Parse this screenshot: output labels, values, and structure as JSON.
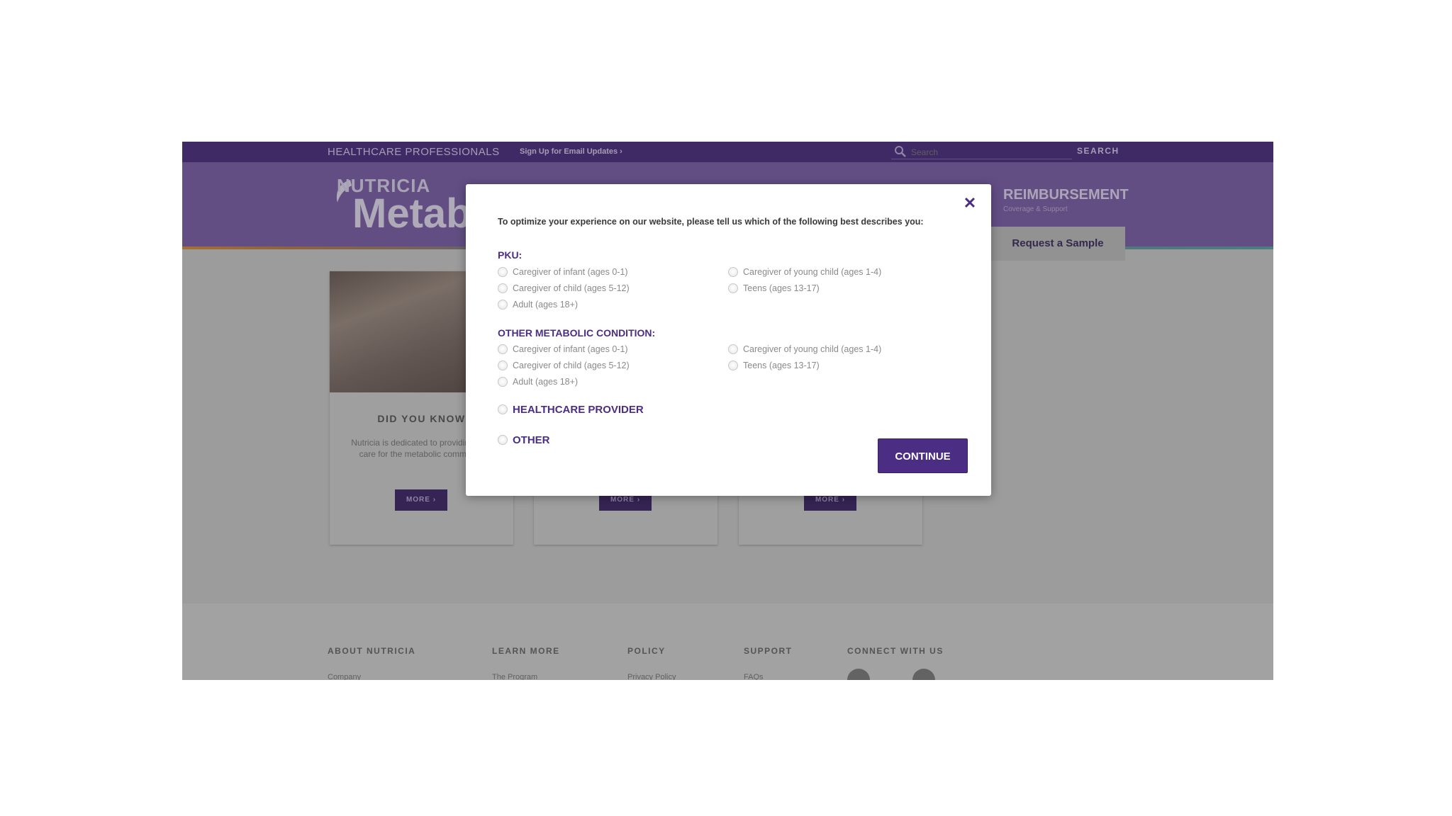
{
  "topbar": {
    "hcp_label": "HEALTHCARE PROFESSIONALS",
    "signup_label": "Sign Up for Email Updates ›",
    "search_placeholder": "Search",
    "search_button": "SEARCH"
  },
  "header": {
    "logo_top": "NUTRICIA",
    "logo_main": "Metab",
    "nav_reimbursement": "REIMBURSEMENT",
    "nav_reimbursement_sub": "Coverage & Support",
    "request_sample": "Request a Sample"
  },
  "cards": [
    {
      "title": "DID YOU KNOW",
      "body": "Nutricia is dedicated to providing best care for the metabolic community",
      "more": "MORE ›"
    },
    {
      "more": "MORE ›"
    },
    {
      "more": "MORE ›"
    }
  ],
  "footer": {
    "headings": [
      "ABOUT NUTRICIA",
      "LEARN MORE",
      "POLICY",
      "SUPPORT",
      "CONNECT WITH US"
    ],
    "links": [
      "Company",
      "The Program",
      "Privacy Policy",
      "FAQs"
    ]
  },
  "modal": {
    "intro": "To optimize your experience on our website, please tell us which of the following best describes you:",
    "pku_heading": "PKU:",
    "pku_options": [
      "Caregiver of infant (ages 0-1)",
      "Caregiver of young child (ages 1-4)",
      "Caregiver of child (ages 5-12)",
      "Teens (ages 13-17)",
      "Adult (ages 18+)"
    ],
    "omc_heading": "OTHER METABOLIC CONDITION:",
    "omc_options": [
      "Caregiver of infant (ages 0-1)",
      "Caregiver of young child (ages 1-4)",
      "Caregiver of child (ages 5-12)",
      "Teens (ages 13-17)",
      "Adult (ages 18+)"
    ],
    "healthcare_provider": "HEALTHCARE PROVIDER",
    "other": "OTHER",
    "continue": "CONTINUE",
    "close_glyph": "✕"
  },
  "colors": {
    "brand_purple": "#4b2d84",
    "header_purple": "#7b5ea8",
    "topbar_purple": "#4a2c7f"
  }
}
